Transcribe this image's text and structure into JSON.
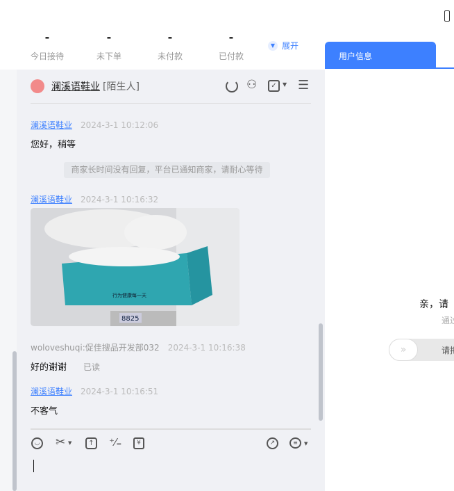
{
  "stats": [
    {
      "value": "-",
      "label": "今日接待"
    },
    {
      "value": "-",
      "label": "未下单"
    },
    {
      "value": "-",
      "label": "未付款"
    },
    {
      "value": "-",
      "label": "已付款"
    }
  ],
  "expand_label": "展开",
  "right_tab": "用户信息",
  "chat_header": {
    "name": "澜溪语鞋业",
    "tag": "[陌生人]"
  },
  "messages": [
    {
      "sender": "澜溪语鞋业",
      "time": "2024-3-1 10:12:06",
      "text": "您好，稍等"
    },
    {
      "system": "商家长时间没有回复，平台已通知商家，请耐心等待"
    },
    {
      "sender": "澜溪语鞋业",
      "time": "2024-3-1 10:16:32",
      "image_text": "行为健康每一天",
      "scale_reading": "8825"
    },
    {
      "sender": "woloveshuqi:促佳搜品开发部032",
      "time": "2024-3-1 10:16:38",
      "text": "好的谢谢",
      "status": "已读"
    },
    {
      "sender": "澜溪语鞋业",
      "time": "2024-3-1 10:16:51",
      "text": "不客气"
    }
  ],
  "right_panel": {
    "title": "亲，请",
    "subtitle": "通过",
    "slider_text": "请拖"
  }
}
